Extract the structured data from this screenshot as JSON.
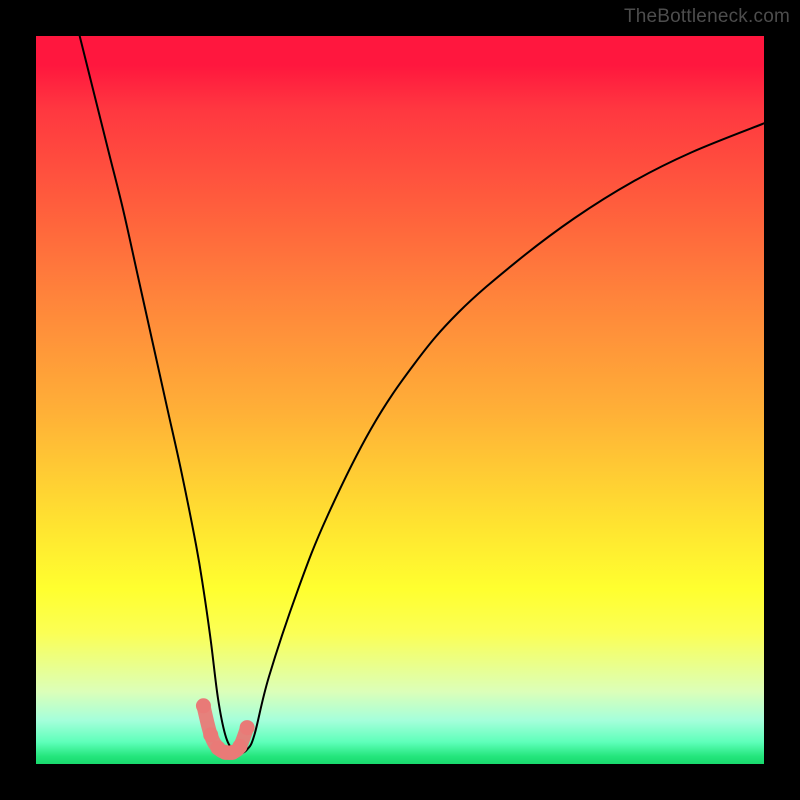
{
  "watermark": "TheBottleneck.com",
  "chart_data": {
    "type": "line",
    "title": "",
    "xlabel": "",
    "ylabel": "",
    "xlim": [
      0,
      100
    ],
    "ylim": [
      0,
      100
    ],
    "grid": false,
    "series": [
      {
        "name": "curve",
        "color": "#000000",
        "x": [
          6,
          8,
          10,
          12,
          14,
          16,
          18,
          20,
          22,
          23,
          24,
          25,
          26,
          27,
          28,
          29,
          30,
          32,
          36,
          40,
          46,
          52,
          58,
          66,
          74,
          82,
          90,
          100
        ],
        "y": [
          100,
          92,
          84,
          76,
          67,
          58,
          49,
          40,
          30,
          24,
          17,
          9,
          4,
          2,
          1.5,
          2,
          4,
          12,
          24,
          34,
          46,
          55,
          62,
          69,
          75,
          80,
          84,
          88
        ]
      },
      {
        "name": "highlight",
        "color": "#e97a77",
        "x": [
          23,
          24,
          25,
          26,
          27,
          28,
          29
        ],
        "y": [
          8,
          4,
          2.2,
          1.6,
          1.6,
          2.4,
          5
        ]
      }
    ]
  }
}
